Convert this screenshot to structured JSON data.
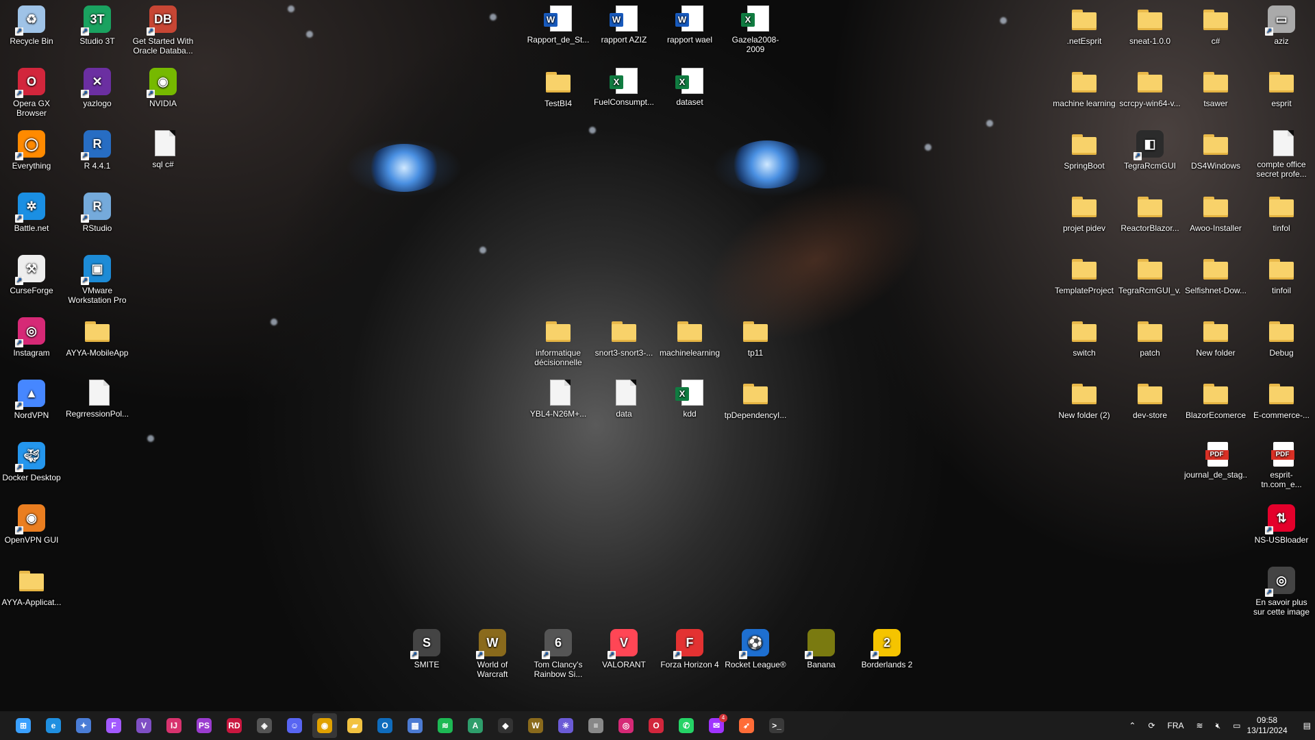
{
  "desktop": {
    "left_column": [
      {
        "label": "Recycle Bin",
        "icon": "recycle-bin-icon"
      },
      {
        "label": "Opera GX Browser",
        "icon": "opera-gx-icon"
      },
      {
        "label": "Everything",
        "icon": "everything-search-icon"
      },
      {
        "label": "Battle.net",
        "icon": "battle-net-icon"
      },
      {
        "label": "CurseForge",
        "icon": "curseforge-icon"
      },
      {
        "label": "Instagram",
        "icon": "instagram-icon"
      },
      {
        "label": "NordVPN",
        "icon": "nordvpn-icon"
      },
      {
        "label": "Docker Desktop",
        "icon": "docker-icon"
      },
      {
        "label": "OpenVPN GUI",
        "icon": "openvpn-icon"
      },
      {
        "label": "AYYA-Applicat...",
        "icon": "folder-icon"
      }
    ],
    "second_column": [
      {
        "label": "Studio 3T",
        "icon": "studio-3t-icon"
      },
      {
        "label": "yazlogo",
        "icon": "yazlogo-icon"
      },
      {
        "label": "R 4.4.1",
        "icon": "r-language-icon"
      },
      {
        "label": "RStudio",
        "icon": "rstudio-icon"
      },
      {
        "label": "VMware Workstation Pro",
        "icon": "vmware-icon"
      },
      {
        "label": "AYYA-MobileApp",
        "icon": "folder-icon"
      },
      {
        "label": "RegrressionPol...",
        "icon": "text-file-icon"
      }
    ],
    "third_column": [
      {
        "label": "Get Started With Oracle Databa...",
        "icon": "oracle-database-icon"
      },
      {
        "label": "NVIDIA",
        "icon": "nvidia-icon"
      },
      {
        "label": "sql c#",
        "icon": "text-file-icon"
      }
    ],
    "center_top": [
      {
        "label": "Rapport_de_St...",
        "icon": "word-document-icon"
      },
      {
        "label": "rapport AZIZ",
        "icon": "word-document-icon"
      },
      {
        "label": "rapport wael",
        "icon": "word-document-icon"
      },
      {
        "label": "Gazela2008-2009",
        "icon": "excel-document-icon"
      },
      {
        "label": "TestBI4",
        "icon": "folder-icon"
      },
      {
        "label": "FuelConsumpt...",
        "icon": "excel-document-icon"
      },
      {
        "label": "dataset",
        "icon": "excel-document-icon"
      }
    ],
    "center_mid": [
      {
        "label": "informatique décisionnelle",
        "icon": "folder-icon"
      },
      {
        "label": "snort3-snort3-...",
        "icon": "folder-icon"
      },
      {
        "label": "machinelearning",
        "icon": "folder-icon"
      },
      {
        "label": "tp11",
        "icon": "folder-icon"
      },
      {
        "label": "YBL4-N26M+...",
        "icon": "text-file-icon"
      },
      {
        "label": "data",
        "icon": "text-file-icon"
      },
      {
        "label": "kdd",
        "icon": "excel-document-icon"
      },
      {
        "label": "tpDependencyI...",
        "icon": "folder-icon"
      }
    ],
    "right": [
      {
        "label": ".netEsprit",
        "icon": "folder-icon"
      },
      {
        "label": "sneat-1.0.0",
        "icon": "folder-icon"
      },
      {
        "label": "c#",
        "icon": "folder-icon"
      },
      {
        "label": "aziz",
        "icon": "drive-icon"
      },
      {
        "label": "machine learning",
        "icon": "folder-icon"
      },
      {
        "label": "scrcpy-win64-v...",
        "icon": "folder-icon"
      },
      {
        "label": "tsawer",
        "icon": "folder-icon"
      },
      {
        "label": "esprit",
        "icon": "folder-icon"
      },
      {
        "label": "SpringBoot",
        "icon": "folder-icon"
      },
      {
        "label": "TegraRcmGUI",
        "icon": "tegra-rcm-icon"
      },
      {
        "label": "DS4Windows",
        "icon": "folder-icon"
      },
      {
        "label": "compte office secret profe...",
        "icon": "text-file-icon"
      },
      {
        "label": "projet pidev",
        "icon": "folder-icon"
      },
      {
        "label": "ReactorBlazor...",
        "icon": "folder-icon"
      },
      {
        "label": "Awoo-Installer",
        "icon": "folder-icon"
      },
      {
        "label": "tinfol",
        "icon": "folder-icon"
      },
      {
        "label": "TemplateProject",
        "icon": "folder-icon"
      },
      {
        "label": "TegraRcmGUI_v...",
        "icon": "folder-icon"
      },
      {
        "label": "Selfishnet-Dow...",
        "icon": "folder-icon"
      },
      {
        "label": "tinfoil",
        "icon": "folder-icon"
      },
      {
        "label": "switch",
        "icon": "folder-icon"
      },
      {
        "label": "patch",
        "icon": "folder-icon"
      },
      {
        "label": "New folder",
        "icon": "folder-icon"
      },
      {
        "label": "Debug",
        "icon": "folder-icon"
      },
      {
        "label": "New folder (2)",
        "icon": "folder-icon"
      },
      {
        "label": "dev-store",
        "icon": "folder-icon"
      },
      {
        "label": "BlazorEcomerce",
        "icon": "folder-icon"
      },
      {
        "label": "E-commerce-...",
        "icon": "folder-icon"
      },
      {
        "label": "journal_de_stag...",
        "icon": "pdf-icon"
      },
      {
        "label": "esprit-tn.com_e...",
        "icon": "pdf-icon"
      },
      {
        "label": "NS-USBloader",
        "icon": "ns-usbloader-icon"
      },
      {
        "label": "En savoir plus sur cette image",
        "icon": "camera-icon"
      }
    ],
    "games": [
      {
        "label": "SMITE",
        "icon": "smite-icon"
      },
      {
        "label": "World of Warcraft",
        "icon": "world-of-warcraft-icon"
      },
      {
        "label": "Tom Clancy's Rainbow Si...",
        "icon": "rainbow-six-icon"
      },
      {
        "label": "VALORANT",
        "icon": "valorant-icon"
      },
      {
        "label": "Forza Horizon 4",
        "icon": "forza-horizon-icon"
      },
      {
        "label": "Rocket League®",
        "icon": "rocket-league-icon"
      },
      {
        "label": "Banana",
        "icon": "banana-icon"
      },
      {
        "label": "Borderlands 2",
        "icon": "borderlands-icon"
      }
    ]
  },
  "taskbar": {
    "apps": [
      {
        "name": "start-button",
        "icon": "windows-icon",
        "glyph": "⊞",
        "color": "#3aa0ff"
      },
      {
        "name": "edge",
        "icon": "edge-icon",
        "glyph": "e",
        "color": "#1f8fe0"
      },
      {
        "name": "app-store",
        "icon": "star-app-icon",
        "glyph": "✦",
        "color": "#4a7dd6"
      },
      {
        "name": "figma",
        "icon": "figma-icon",
        "glyph": "F",
        "color": "#a259ff"
      },
      {
        "name": "visual-studio",
        "icon": "visual-studio-icon",
        "glyph": "V",
        "color": "#7f4fc4"
      },
      {
        "name": "intellij",
        "icon": "intellij-icon",
        "glyph": "IJ",
        "color": "#d8336e"
      },
      {
        "name": "phpstorm",
        "icon": "phpstorm-icon",
        "glyph": "PS",
        "color": "#9b3ccf"
      },
      {
        "name": "rider",
        "icon": "rider-icon",
        "glyph": "RD",
        "color": "#c9173f"
      },
      {
        "name": "unity",
        "icon": "unity-icon",
        "glyph": "◈",
        "color": "#555555"
      },
      {
        "name": "discord",
        "icon": "discord-icon",
        "glyph": "☺",
        "color": "#5865f2"
      },
      {
        "name": "chrome",
        "icon": "chrome-icon",
        "glyph": "◉",
        "color": "#e0a100",
        "active": true
      },
      {
        "name": "file-explorer",
        "icon": "folder-icon",
        "glyph": "▰",
        "color": "#f2c240"
      },
      {
        "name": "outlook",
        "icon": "outlook-icon",
        "glyph": "O",
        "color": "#0f6cbd"
      },
      {
        "name": "network",
        "icon": "network-icon",
        "glyph": "▦",
        "color": "#4c7bd3"
      },
      {
        "name": "spotify",
        "icon": "spotify-icon",
        "glyph": "≋",
        "color": "#1db954"
      },
      {
        "name": "android-studio",
        "icon": "android-studio-icon",
        "glyph": "A",
        "color": "#2e9e6b"
      },
      {
        "name": "riot",
        "icon": "riot-icon",
        "glyph": "◆",
        "color": "#333333"
      },
      {
        "name": "wow",
        "icon": "world-of-warcraft-icon",
        "glyph": "W",
        "color": "#8a6a1c"
      },
      {
        "name": "settings-app",
        "icon": "gear-icon",
        "glyph": "✳",
        "color": "#6b5bd6"
      },
      {
        "name": "database",
        "icon": "database-icon",
        "glyph": "≡",
        "color": "#888888"
      },
      {
        "name": "instagram",
        "icon": "instagram-icon",
        "glyph": "◎",
        "color": "#d62976"
      },
      {
        "name": "opera",
        "icon": "opera-icon",
        "glyph": "O",
        "color": "#d2263c"
      },
      {
        "name": "whatsapp",
        "icon": "whatsapp-icon",
        "glyph": "✆",
        "color": "#25d366"
      },
      {
        "name": "messenger",
        "icon": "messenger-icon",
        "glyph": "✉",
        "color": "#a033ff",
        "badge": "4"
      },
      {
        "name": "postman",
        "icon": "postman-icon",
        "glyph": "➶",
        "color": "#ff6c37"
      },
      {
        "name": "terminal",
        "icon": "terminal-icon",
        "glyph": ">_",
        "color": "#3a3a3a"
      }
    ],
    "tray": {
      "language": "FRA",
      "time": "09:58",
      "date": "13/11/2024"
    }
  }
}
